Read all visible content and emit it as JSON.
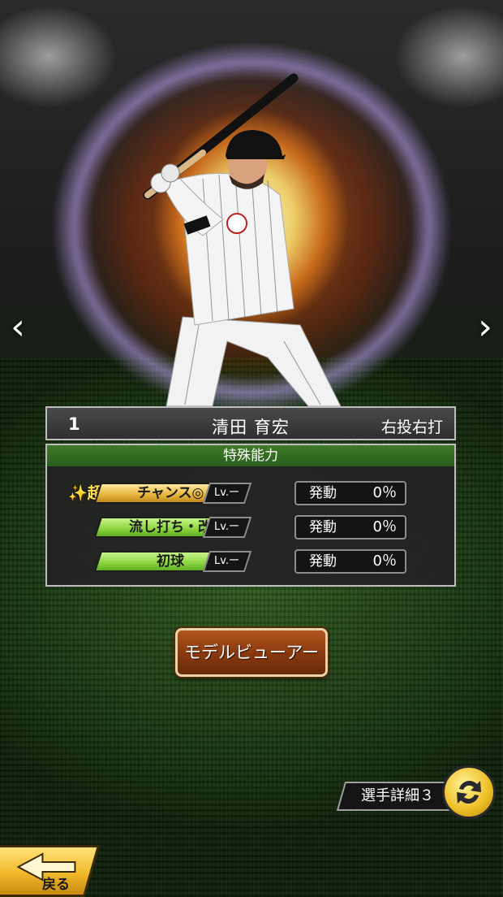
{
  "header": {
    "number": "1",
    "player_name": "清田 育宏",
    "handedness": "右投右打"
  },
  "abilities_panel": {
    "title": "特殊能力",
    "rows": [
      {
        "super_prefix": "✨超",
        "label": "チャンス◎",
        "level": "Lv.ー",
        "status_label": "発動",
        "percent": "0％",
        "label_color": "#e6b43c"
      },
      {
        "super_prefix": "",
        "label": "流し打ち・改",
        "level": "Lv.ー",
        "status_label": "発動",
        "percent": "0％",
        "label_color": "#8ad43e"
      },
      {
        "super_prefix": "",
        "label": "初球",
        "level": "Lv.ー",
        "status_label": "発動",
        "percent": "0％",
        "label_color": "#8ad43e"
      }
    ]
  },
  "buttons": {
    "model_viewer": "モデルビューアー",
    "player_detail": "選手詳細３",
    "back": "戻る"
  },
  "icons": {
    "prev": "chevron-left-icon",
    "next": "chevron-right-icon",
    "swap": "swap-arrows-icon",
    "back": "back-arrow-icon"
  },
  "colors": {
    "panel_header": "#2f6b22",
    "model_button": "#8a3a10",
    "swap_button": "#f0c22a",
    "back_button": "#f2b92c"
  }
}
